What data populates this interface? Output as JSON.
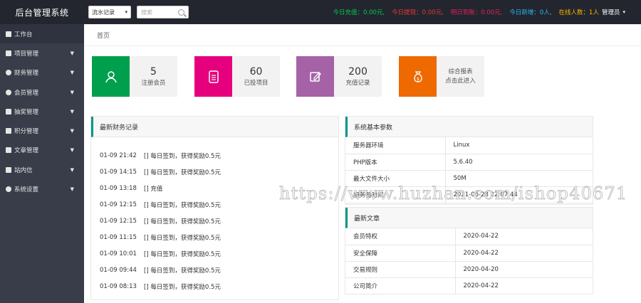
{
  "header": {
    "title": "后台管理系统",
    "select_value": "流水记录",
    "search_placeholder": "搜索",
    "stats": [
      {
        "text": "今日充值：0.00元,",
        "color": "#00c853"
      },
      {
        "text": "今日提现：0.00元,",
        "color": "#e53935"
      },
      {
        "text": "明日到账：0.00元,",
        "color": "#e91e63"
      },
      {
        "text": "今日新增：0人,",
        "color": "#29b6f6"
      },
      {
        "text": "在线人数：1人",
        "color": "#ffb300"
      }
    ],
    "admin_label": "管理员"
  },
  "sidebar": {
    "items": [
      {
        "label": "工作台",
        "icon": "grid-icon",
        "has_arrow": false
      },
      {
        "label": "项目管理",
        "icon": "doc-icon",
        "has_arrow": true
      },
      {
        "label": "财务管理",
        "icon": "money-icon",
        "has_arrow": true
      },
      {
        "label": "会员管理",
        "icon": "user-icon",
        "has_arrow": true
      },
      {
        "label": "抽奖管理",
        "icon": "file-icon",
        "has_arrow": true
      },
      {
        "label": "积分管理",
        "icon": "file-icon",
        "has_arrow": true
      },
      {
        "label": "文章管理",
        "icon": "file-icon",
        "has_arrow": true
      },
      {
        "label": "站内信",
        "icon": "mail-icon",
        "has_arrow": true
      },
      {
        "label": "系统设置",
        "icon": "gear-icon",
        "has_arrow": true
      }
    ]
  },
  "breadcrumb": "首页",
  "cards": [
    {
      "value": "5",
      "label": "注册会员",
      "color": "#009f4d",
      "icon": "user-icon"
    },
    {
      "value": "60",
      "label": "已投项目",
      "color": "#e6007e",
      "icon": "document-icon"
    },
    {
      "value": "200",
      "label": "充值记录",
      "color": "#a562a7",
      "icon": "edit-icon"
    },
    {
      "line1": "综合报表",
      "line2": "点击此进入",
      "color": "#ee6a00",
      "icon": "money-bag-icon"
    }
  ],
  "finance_panel": {
    "title": "最新财务记录",
    "rows": [
      {
        "time": "01-09 21:42",
        "desc": "[] 每日签到，获得奖励0.5元"
      },
      {
        "time": "01-09 14:15",
        "desc": "[] 每日签到，获得奖励0.5元"
      },
      {
        "time": "01-09 13:18",
        "desc": "[] 充值"
      },
      {
        "time": "01-09 12:15",
        "desc": "[] 每日签到，获得奖励0.5元"
      },
      {
        "time": "01-09 12:15",
        "desc": "[] 每日签到，获得奖励0.5元"
      },
      {
        "time": "01-09 11:15",
        "desc": "[] 每日签到，获得奖励0.5元"
      },
      {
        "time": "01-09 10:01",
        "desc": "[] 每日签到，获得奖励0.5元"
      },
      {
        "time": "01-09 09:44",
        "desc": "[] 每日签到，获得奖励0.5元"
      },
      {
        "time": "01-09 08:13",
        "desc": "[] 每日签到，获得奖励0.5元"
      }
    ]
  },
  "system_panel": {
    "title": "系统基本参数",
    "rows": [
      {
        "key": "服务器环境",
        "value": "Linux"
      },
      {
        "key": "PHP版本",
        "value": "5.6.40"
      },
      {
        "key": "最大文件大小",
        "value": "50M"
      },
      {
        "key": "服务器时间",
        "value": "2021-06-28 22:07:44"
      }
    ]
  },
  "articles_panel": {
    "title": "最新文章",
    "rows": [
      {
        "name": "会员特权",
        "date": "2020-04-22"
      },
      {
        "name": "安全保障",
        "date": "2020-04-22"
      },
      {
        "name": "交易规则",
        "date": "2020-04-20"
      },
      {
        "name": "公司简介",
        "date": "2020-04-22"
      }
    ]
  },
  "watermark": "https://www.huzhan.com/ishop40671"
}
